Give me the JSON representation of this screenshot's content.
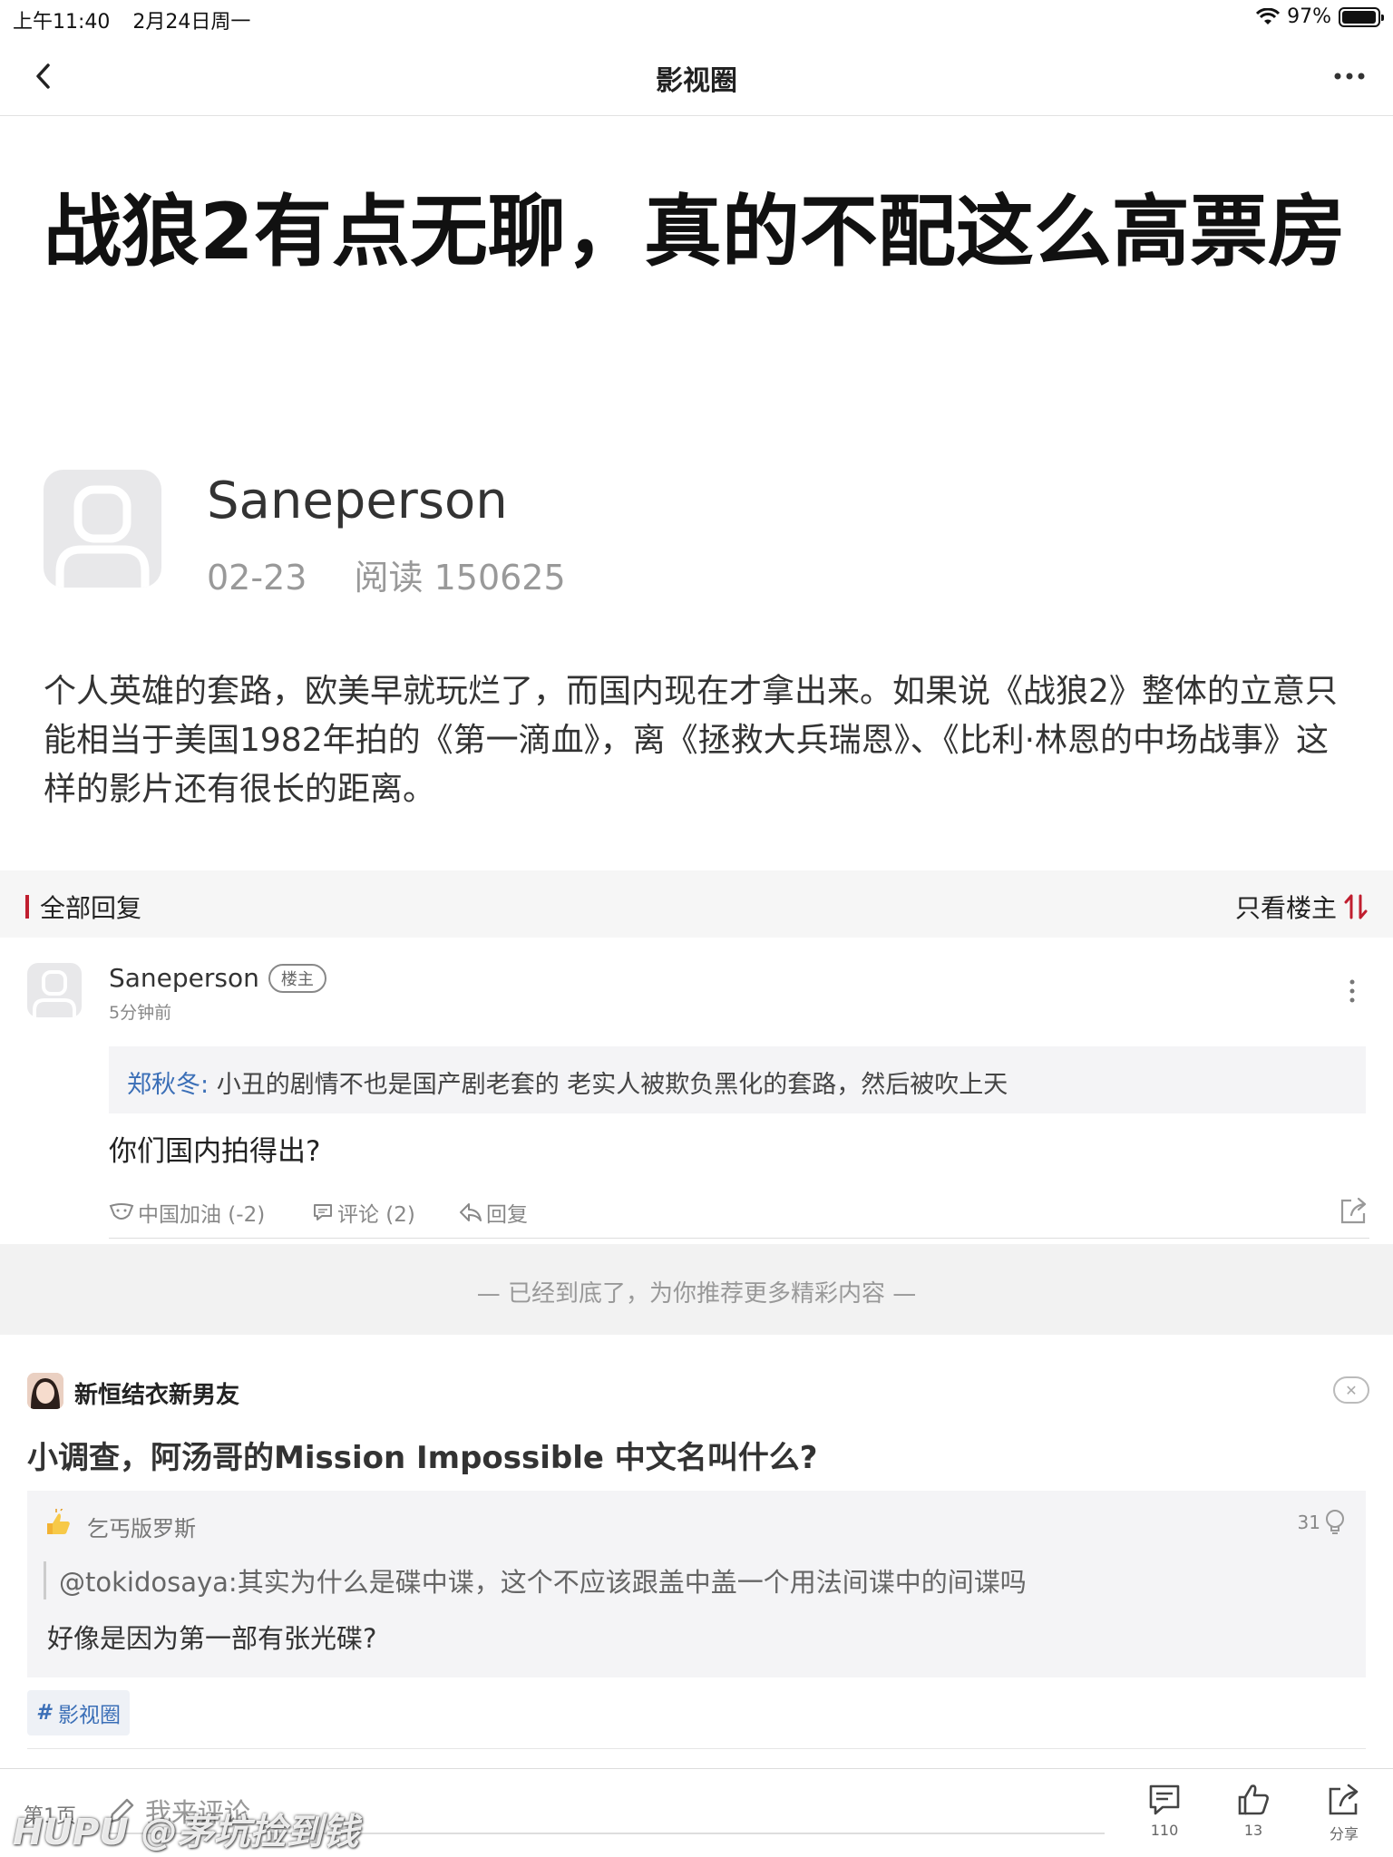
{
  "status_bar": {
    "time": "上午11:40",
    "date": "2月24日周一",
    "battery_pct": "97%",
    "battery_level": 0.97
  },
  "nav": {
    "title": "影视圈"
  },
  "post": {
    "title": "战狼2有点无聊，真的不配这么高票房",
    "author": "Saneperson",
    "date": "02-23",
    "reads": "阅读 150625",
    "body": "个人英雄的套路，欧美早就玩烂了，而国内现在才拿出来。如果说《战狼2》整体的立意只能相当于美国1982年拍的《第一滴血》，离《拯救大兵瑞恩》、《比利·林恩的中场战事》这样的影片还有很长的距离。"
  },
  "replies_header": {
    "label": "全部回复",
    "filter": "只看楼主"
  },
  "reply": {
    "author": "Saneperson",
    "badge": "楼主",
    "time": "5分钟前",
    "quote_author": "郑秋冬:",
    "quote_text": " 小丑的剧情不也是国产剧老套的 老实人被欺负黑化的套路，然后被吹上天",
    "text": "你们国内拍得出?",
    "action_cheer": "中国加油 (-2)",
    "action_comment": "评论 (2)",
    "action_reply": "回复"
  },
  "end_notice": "—   已经到底了，为你推荐更多精彩内容   —",
  "recommend": {
    "user": "新恒结衣新男友",
    "title": "小调查，阿汤哥的Mission Impossible 中文名叫什么?",
    "box_user": "乞丐版罗斯",
    "box_likes": "31",
    "box_quote": "@tokidosaya:其实为什么是碟中谍，这个不应该跟盖中盖一个用法间谍中的间谍吗",
    "box_text": "好像是因为第一部有张光碟?",
    "tag": "影视圈"
  },
  "bottom_bar": {
    "page": "第1页",
    "comment_placeholder": "我来评论",
    "comments_count": "110",
    "likes_count": "13",
    "share_label": "分享"
  },
  "watermark": "HUPU @茅坑捡到钱",
  "colors": {
    "accent_red": "#c01e2f",
    "link_blue": "#3b6fb7"
  }
}
